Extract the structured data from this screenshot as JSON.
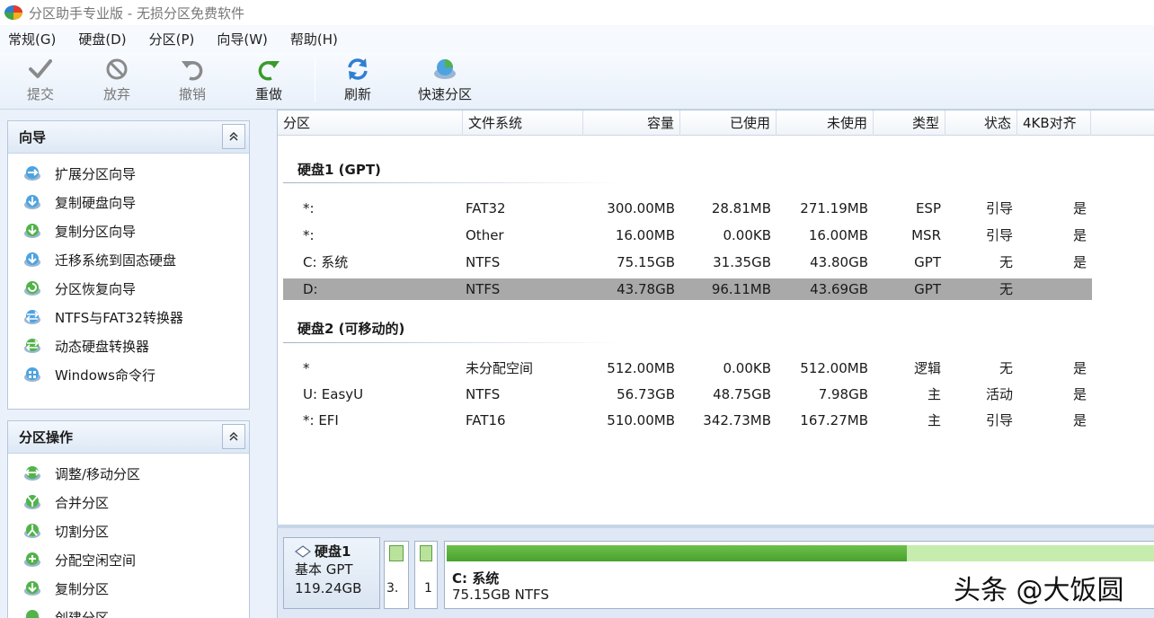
{
  "window": {
    "title": "分区助手专业版 - 无损分区免费软件"
  },
  "menu": [
    "常规(G)",
    "硬盘(D)",
    "分区(P)",
    "向导(W)",
    "帮助(H)"
  ],
  "toolbar": {
    "commit": "提交",
    "discard": "放弃",
    "undo": "撤销",
    "redo": "重做",
    "refresh": "刷新",
    "quick_partition": "快速分区"
  },
  "wizard_panel": {
    "title": "向导",
    "items": [
      "扩展分区向导",
      "复制硬盘向导",
      "复制分区向导",
      "迁移系统到固态硬盘",
      "分区恢复向导",
      "NTFS与FAT32转换器",
      "动态硬盘转换器",
      "Windows命令行"
    ]
  },
  "ops_panel": {
    "title": "分区操作",
    "items": [
      "调整/移动分区",
      "合并分区",
      "切割分区",
      "分配空闲空间",
      "复制分区",
      "创建分区"
    ]
  },
  "table": {
    "columns": [
      "分区",
      "文件系统",
      "容量",
      "已使用",
      "未使用",
      "类型",
      "状态",
      "4KB对齐"
    ],
    "disks": [
      {
        "heading": "硬盘1 (GPT)",
        "rows": [
          [
            "*:",
            "FAT32",
            "300.00MB",
            "28.81MB",
            "271.19MB",
            "ESP",
            "引导",
            "是"
          ],
          [
            "*:",
            "Other",
            "16.00MB",
            "0.00KB",
            "16.00MB",
            "MSR",
            "引导",
            "是"
          ],
          [
            "C: 系统",
            "NTFS",
            "75.15GB",
            "31.35GB",
            "43.80GB",
            "GPT",
            "无",
            "是"
          ],
          [
            "D:",
            "NTFS",
            "43.78GB",
            "96.11MB",
            "43.69GB",
            "GPT",
            "无",
            ""
          ]
        ]
      },
      {
        "heading": "硬盘2 (可移动的)",
        "rows": [
          [
            "*",
            "未分配空间",
            "512.00MB",
            "0.00KB",
            "512.00MB",
            "逻辑",
            "无",
            "是"
          ],
          [
            "U: EasyU",
            "NTFS",
            "56.73GB",
            "48.75GB",
            "7.98GB",
            "主",
            "活动",
            "是"
          ],
          [
            "*: EFI",
            "FAT16",
            "510.00MB",
            "342.73MB",
            "167.27MB",
            "主",
            "引导",
            "是"
          ]
        ]
      }
    ],
    "selected_row": "D:"
  },
  "diskmap": {
    "disk_name": "硬盘1",
    "disk_type": "基本 GPT",
    "disk_size": "119.24GB",
    "small_part_1": "3.",
    "small_part_2": "1",
    "system_partition": {
      "name": "C: 系统",
      "info": "75.15GB NTFS",
      "used_fraction": 0.42
    }
  },
  "watermark": "头条 @大饭圆"
}
